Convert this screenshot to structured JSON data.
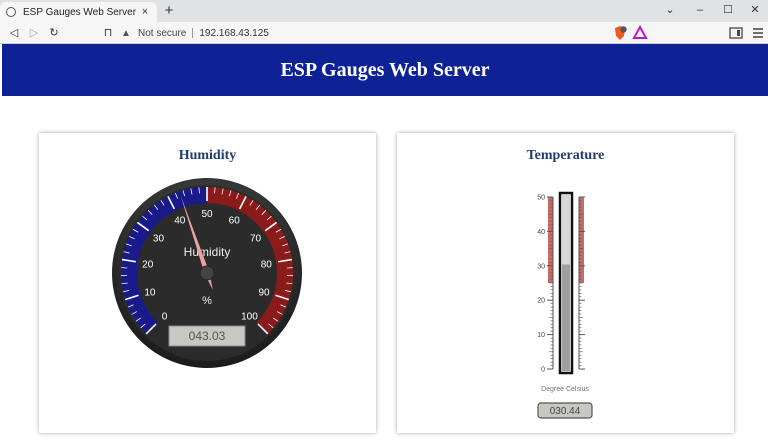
{
  "browser": {
    "tab_title": "ESP Gauges Web Server",
    "tab_close": "×",
    "new_tab": "+",
    "security_label": "Not secure",
    "url": "192.168.43.125"
  },
  "page": {
    "header_title": "ESP Gauges Web Server"
  },
  "humidity": {
    "card_title": "Humidity",
    "gauge_label": "Humidity",
    "unit": "%",
    "value": 43.03,
    "display_value": "043.03",
    "min": 0,
    "max": 100,
    "tick_labels": [
      "0",
      "10",
      "20",
      "30",
      "40",
      "50",
      "60",
      "70",
      "80",
      "90",
      "100"
    ],
    "low_zone_color": "#1a1a8a",
    "high_zone_color": "#8b1a1a"
  },
  "temperature": {
    "card_title": "Temperature",
    "unit_label": "Degree Celsius",
    "value": 30.44,
    "display_value": "030.44",
    "min": 0,
    "max": 50,
    "tick_labels": [
      "0",
      "10",
      "20",
      "30",
      "40",
      "50"
    ],
    "highlight_from": 25,
    "highlight_to": 50,
    "highlight_color": "#c0504d"
  },
  "colors": {
    "header_bg": "#0f2295",
    "card_title": "#1f3d6d"
  }
}
